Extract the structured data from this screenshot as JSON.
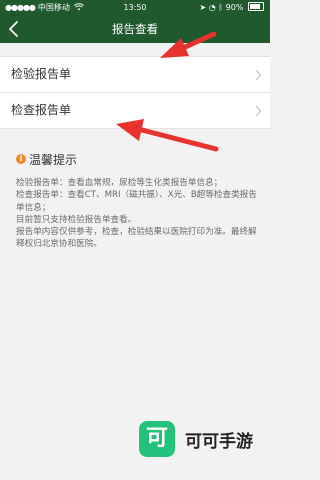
{
  "status_bar": {
    "carrier": "中国移动",
    "time": "13:50",
    "battery": "90%"
  },
  "nav": {
    "title": "报告查看"
  },
  "list": [
    {
      "label": "检验报告单"
    },
    {
      "label": "检查报告单"
    }
  ],
  "tips": {
    "title": "温馨提示",
    "lines": [
      "检验报告单：查看血常规，尿检等生化类报告单信息；",
      "检查报告单：查看CT、MRI（磁共振）、X光、B超等检查类报告单信息；",
      "目前暂只支持检验报告单查看。",
      "报告单内容仅供参考，检查，检验结果以医院打印为准。最终解释权归北京协和医院。"
    ]
  },
  "watermark": {
    "logo_char": "可",
    "text": "可可手游"
  },
  "colors": {
    "header": "#1f5a2c",
    "arrow": "#e8322c",
    "tip_icon": "#f08a24",
    "watermark_logo": "#22c27a"
  }
}
